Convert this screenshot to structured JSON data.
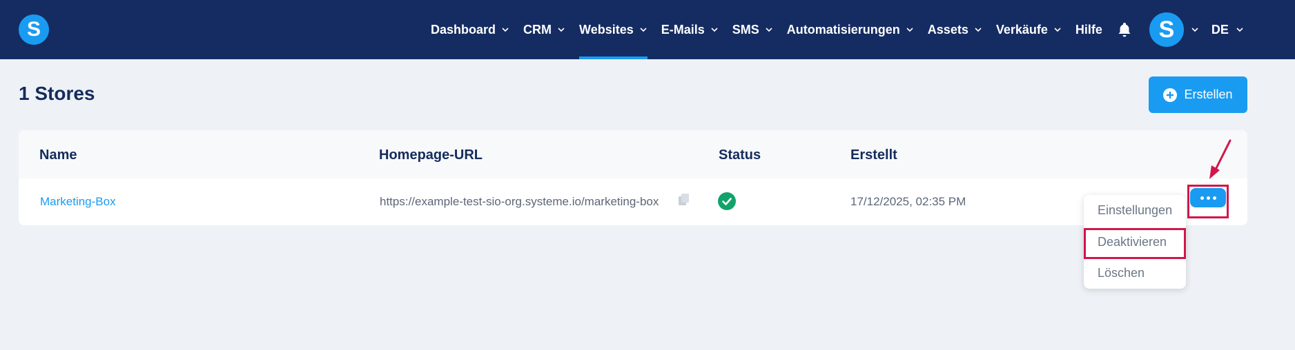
{
  "app": {
    "logo_letter": "S",
    "brand_color": "#1a9bf2",
    "topbar_color": "#152c62"
  },
  "nav": {
    "items": [
      {
        "label": "Dashboard",
        "dropdown": true,
        "active": false
      },
      {
        "label": "CRM",
        "dropdown": true,
        "active": false
      },
      {
        "label": "Websites",
        "dropdown": true,
        "active": true
      },
      {
        "label": "E-Mails",
        "dropdown": true,
        "active": false
      },
      {
        "label": "SMS",
        "dropdown": true,
        "active": false
      },
      {
        "label": "Automatisierungen",
        "dropdown": true,
        "active": false
      },
      {
        "label": "Assets",
        "dropdown": true,
        "active": false
      },
      {
        "label": "Verkäufe",
        "dropdown": true,
        "active": false
      },
      {
        "label": "Hilfe",
        "dropdown": false,
        "active": false
      }
    ],
    "avatar_letter": "S",
    "language": "DE"
  },
  "page": {
    "title": "1 Stores",
    "create_label": "Erstellen"
  },
  "table": {
    "headers": [
      "Name",
      "Homepage-URL",
      "Status",
      "Erstellt"
    ],
    "rows": [
      {
        "name": "Marketing-Box",
        "url": "https://example-test-sio-org.systeme.io/marketing-box",
        "status": "active",
        "created": "17/12/2025, 02:35 PM"
      }
    ]
  },
  "context_menu": {
    "items": [
      "Einstellungen",
      "Deaktivieren",
      "Löschen"
    ],
    "highlighted": "Deaktivieren"
  },
  "annotation_color": "#d1164a"
}
